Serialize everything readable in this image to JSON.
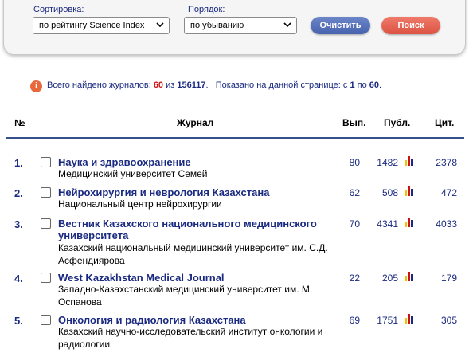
{
  "filters": {
    "sort_label": "Сортировка:",
    "sort_value": "по рейтингу Science Index",
    "order_label": "Порядок:",
    "order_value": "по убыванию",
    "clear_button": "Очистить",
    "search_button": "Поиск"
  },
  "summary": {
    "prefix": "Всего найдено журналов:",
    "found": "60",
    "of_word": "из",
    "total": "156117",
    "shown_prefix": "Показано на данной странице: с",
    "from": "1",
    "to_word": "по",
    "to": "60"
  },
  "table": {
    "headers": {
      "num": "№",
      "journal": "Журнал",
      "issues": "Вып.",
      "pubs": "Публ.",
      "cites": "Цит."
    },
    "rows": [
      {
        "num": "1.",
        "title": "Наука и здравоохранение",
        "org": "Медицинский университет Семей",
        "issues": "80",
        "pubs": "1482",
        "cites": "2378"
      },
      {
        "num": "2.",
        "title": "Нейрохирургия и неврология Казахстана",
        "org": "Национальный центр нейрохирургии",
        "issues": "62",
        "pubs": "508",
        "cites": "472"
      },
      {
        "num": "3.",
        "title": "Вестник Казахского национального медицинского университета",
        "org": "Казахский национальный медицинский университет им. С.Д. Асфендиярова",
        "issues": "70",
        "pubs": "4341",
        "cites": "4033"
      },
      {
        "num": "4.",
        "title": "West Kazakhstan Medical Journal",
        "org": "Западно-Казахстанский медицинский университет им. М. Оспанова",
        "issues": "22",
        "pubs": "205",
        "cites": "179"
      },
      {
        "num": "5.",
        "title": "Онкология и радиология Казахстана",
        "org": "Казахский научно-исследовательский институт онкологии и радиологии",
        "issues": "69",
        "pubs": "1751",
        "cites": "305"
      }
    ]
  },
  "colors": {
    "accent": "#1a2a80",
    "highlight": "#d01010",
    "clear_button": "#4f6bb5",
    "search_button": "#e15d4b",
    "divider": "#37508d"
  },
  "icons": {
    "info": "info-icon",
    "dropdown": "chevron-down-icon",
    "stats": "bar-chart-icon"
  }
}
